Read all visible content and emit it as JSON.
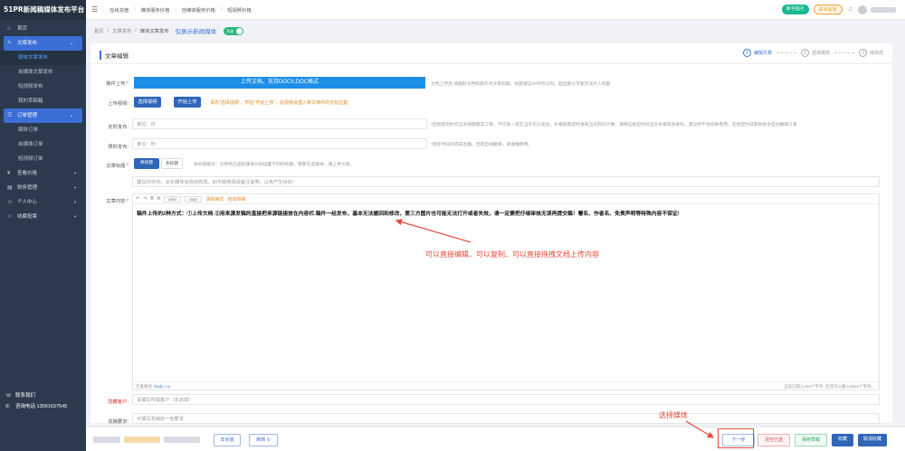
{
  "app": {
    "logo": "51PR新闻稿媒体发布平台"
  },
  "sidebar": {
    "items": [
      {
        "label": "首页",
        "icon": "home-icon"
      },
      {
        "label": "文章发布",
        "icon": "edit-icon"
      },
      {
        "label": "媒体文章发布"
      },
      {
        "label": "自媒体文章发布"
      },
      {
        "label": "短视频发布"
      },
      {
        "label": "我的草稿箱"
      },
      {
        "label": "订单管理",
        "icon": "order-icon"
      },
      {
        "label": "媒体订单"
      },
      {
        "label": "自媒体订单"
      },
      {
        "label": "短视频订单"
      },
      {
        "label": "查看价格",
        "icon": "price-icon"
      },
      {
        "label": "财务管理",
        "icon": "finance-icon"
      },
      {
        "label": "个人中心",
        "icon": "user-icon"
      },
      {
        "label": "收藏投票",
        "icon": "star-icon"
      }
    ],
    "contact": {
      "title": "联系我们",
      "phone_label": "咨询电话",
      "phone": "13061637545"
    }
  },
  "topbar": {
    "nav": [
      "在线充值",
      "媒体服务价格",
      "自媒体服务价格",
      "短视频价格"
    ],
    "guide": "新手指引",
    "service": "联系客服"
  },
  "breadcrumb": {
    "items": [
      "首页",
      "文章发布",
      "媒体文章发布"
    ],
    "toggle_label": "仅展示新闻媒体",
    "toggle_state": "开启"
  },
  "card": {
    "title": "文章编辑",
    "steps": [
      {
        "num": "1",
        "label": "编辑文章"
      },
      {
        "num": "2",
        "label": "选择媒体"
      },
      {
        "num": "3",
        "label": "待完成"
      }
    ]
  },
  "form": {
    "upload": {
      "label": "稿件上传:",
      "button": "上传文档，支持DOCX,DOC格式",
      "hint": "文档上传后 将截取文档标题作为文章标题。标题建议25字符以内。超出部分可能无法计入标题"
    },
    "video": {
      "label": "上传视频:",
      "select": "选择视频",
      "start": "开始上传",
      "hint": "请先\"选择视频\"，然后\"开始上传\"，此视频会插入到文档中的光标位置。"
    },
    "schedule": {
      "label": "定时发布:",
      "placeholder": "单位：日",
      "hint": "*在指定的时间当天到期需实订单。不代表一定在当天可以发出。价格按照定时发布当天的价计算。请保证指定时间当天会按有效发布。建议时不会扣除费用，在指定时日期失败会自动撤销订单"
    },
    "limit": {
      "label": "限时发布:",
      "placeholder": "单位：秒",
      "hint": "*指定时间内完成出稿。否则自动撤单。请谨慎使用。"
    },
    "title_mode": {
      "label": "文章标题:",
      "single": "单标题",
      "multi": "多标题",
      "hint": "多标题模式：为所有已选的媒体分别设置不同的标题。需要先选媒体，再上传文章。"
    },
    "title_input": {
      "placeholder": "建议25字内，太长媒体会自动修改。如不能修改请备注说明，以免产生纠纷！"
    },
    "content": {
      "label": "文章内容:"
    },
    "client": {
      "label": "隐藏客户:",
      "placeholder": "请填写所属客户（非必填）"
    },
    "remark": {
      "label": "发稿要求:",
      "placeholder": "可填写发稿的一些要求"
    }
  },
  "editor": {
    "toolbar": [
      "↶",
      "↷",
      "B",
      "A",
      "arial",
      "16px",
      "清除格式",
      "自动排版"
    ],
    "content": "稿件上传的2种方式：①上传文档 ②用来源发稿的直接把来源链接放在内容栏.稿件一经发布，基本无法撤回和修改，第三方图片也可能无法打开或者失效，请一定要把仔细审核无误再提交稿！署名、作者名、免责声明等特殊内容不保证!",
    "path_label": "元素路径:",
    "path": "body > p",
    "count": "当前已输入155个字符, 您还可以输入9845个字符。"
  },
  "annotations": {
    "editor_note": "可以直接编辑、可以复制、可以直接拖拽文档上传内容",
    "next_note": "选择媒体"
  },
  "bottom": {
    "recharge": "去充值",
    "refresh": "刷新",
    "next": "下一步",
    "clear": "清空已选",
    "save_draft": "保存草稿",
    "favorite": "收藏",
    "cancel_fav": "取消收藏"
  },
  "colors": {
    "accent": "#3b6fd6",
    "annotation": "#e84a3a",
    "sidebar": "#2b3a4d"
  }
}
